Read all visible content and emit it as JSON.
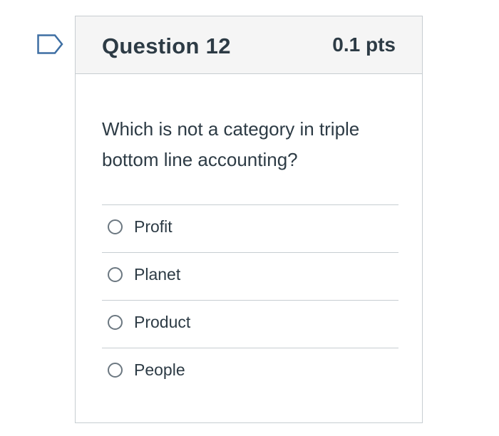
{
  "question": {
    "flag_icon": "bookmark-flag-icon",
    "title": "Question 12",
    "points": "0.1 pts",
    "text": "Which is not a category in triple bottom line accounting?",
    "answers": [
      {
        "label": "Profit"
      },
      {
        "label": "Planet"
      },
      {
        "label": "Product"
      },
      {
        "label": "People"
      }
    ]
  },
  "colors": {
    "header_bg": "#f5f5f5",
    "border": "#c7cdd1",
    "text": "#2d3b45",
    "flag_outline": "#3e6fa3"
  }
}
